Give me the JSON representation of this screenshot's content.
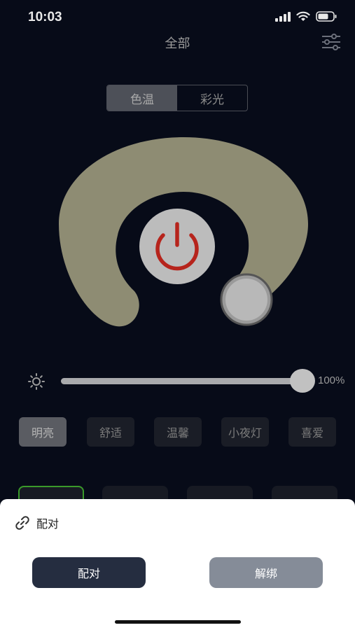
{
  "status_bar": {
    "time": "10:03"
  },
  "header": {
    "title": "全部",
    "filter_icon": "sliders-icon"
  },
  "mode_tabs": [
    {
      "label": "色温",
      "active": true
    },
    {
      "label": "彩光",
      "active": false
    }
  ],
  "dial": {
    "power_icon": "power-icon",
    "ring_color": "#8e8c73",
    "power_color": "#b6241c"
  },
  "brightness": {
    "value_text": "100%",
    "value": 1.0,
    "icon": "sun-icon"
  },
  "presets": [
    {
      "label": "明亮",
      "active": true
    },
    {
      "label": "舒适",
      "active": false
    },
    {
      "label": "温馨",
      "active": false
    },
    {
      "label": "小夜灯",
      "active": false
    },
    {
      "label": "喜爱",
      "active": false
    }
  ],
  "sheet": {
    "title": "配对",
    "title_icon": "link-icon",
    "pair_label": "配对",
    "unbind_label": "解绑"
  }
}
